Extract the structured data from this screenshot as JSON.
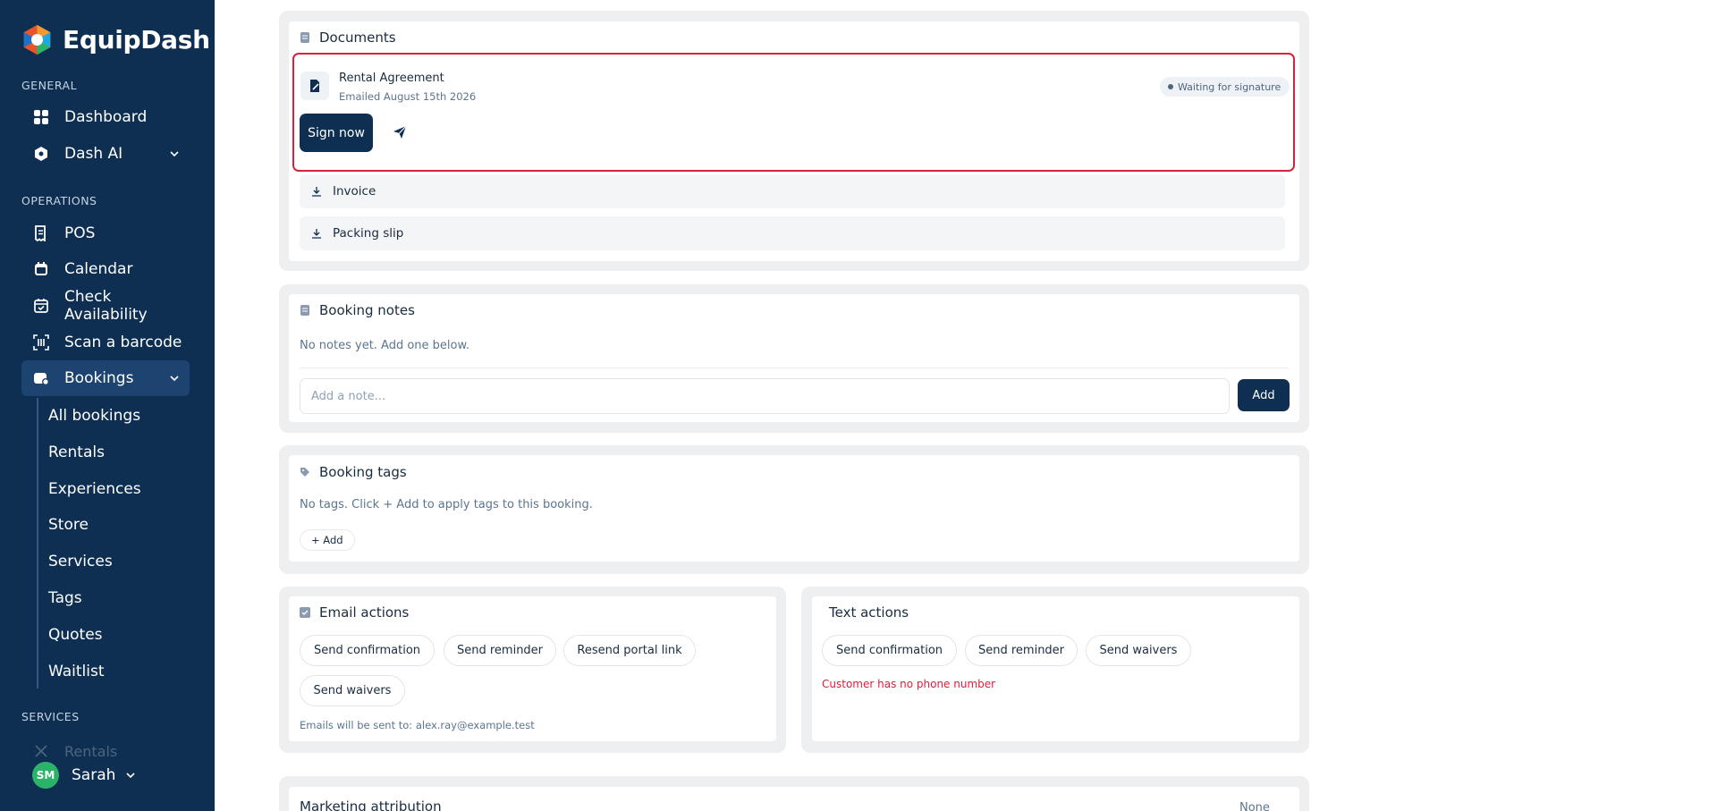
{
  "app": {
    "name": "EquipDash"
  },
  "sidebar": {
    "sections": {
      "general": "GENERAL",
      "operations": "OPERATIONS",
      "services": "SERVICES"
    },
    "items": {
      "dashboard": "Dashboard",
      "dash_ai": "Dash AI",
      "pos": "POS",
      "calendar": "Calendar",
      "check_availability": "Check Availability",
      "scan_barcode": "Scan a barcode",
      "bookings": "Bookings"
    },
    "bookings_sub": [
      "All bookings",
      "Rentals",
      "Experiences",
      "Store",
      "Services",
      "Tags",
      "Quotes",
      "Waitlist"
    ],
    "services_faded_item": "Rentals",
    "user": {
      "initials": "SM",
      "name": "Sarah"
    },
    "colors": {
      "background": "#0e2f52",
      "active": "#1d4470",
      "avatar": "#2bb36a"
    }
  },
  "documents": {
    "title": "Documents",
    "agreement": {
      "title": "Rental Agreement",
      "subtitle": "Emailed August 15th 2026",
      "status": "Waiting for signature",
      "sign_button": "Sign now"
    },
    "rows": [
      "Invoice",
      "Packing slip"
    ]
  },
  "booking_notes": {
    "title": "Booking notes",
    "empty_text": "No notes yet. Add one below.",
    "input_placeholder": "Add a note...",
    "add_button": "Add"
  },
  "booking_tags": {
    "title": "Booking tags",
    "empty_text": "No tags. Click + Add to apply tags to this booking.",
    "add_button": "+ Add"
  },
  "email_actions": {
    "title": "Email actions",
    "buttons": [
      "Send confirmation",
      "Send reminder",
      "Resend portal link",
      "Send waivers"
    ],
    "footnote": "Emails will be sent to: alex.ray@example.test"
  },
  "text_actions": {
    "title": "Text actions",
    "buttons": [
      "Send confirmation",
      "Send reminder",
      "Send waivers"
    ],
    "error": "Customer has no phone number"
  },
  "marketing_attribution": {
    "title": "Marketing attribution",
    "value": "None"
  },
  "colors": {
    "highlight": "#d6223a",
    "primary_button": "#0e2f52",
    "error_text": "#d6223a"
  }
}
